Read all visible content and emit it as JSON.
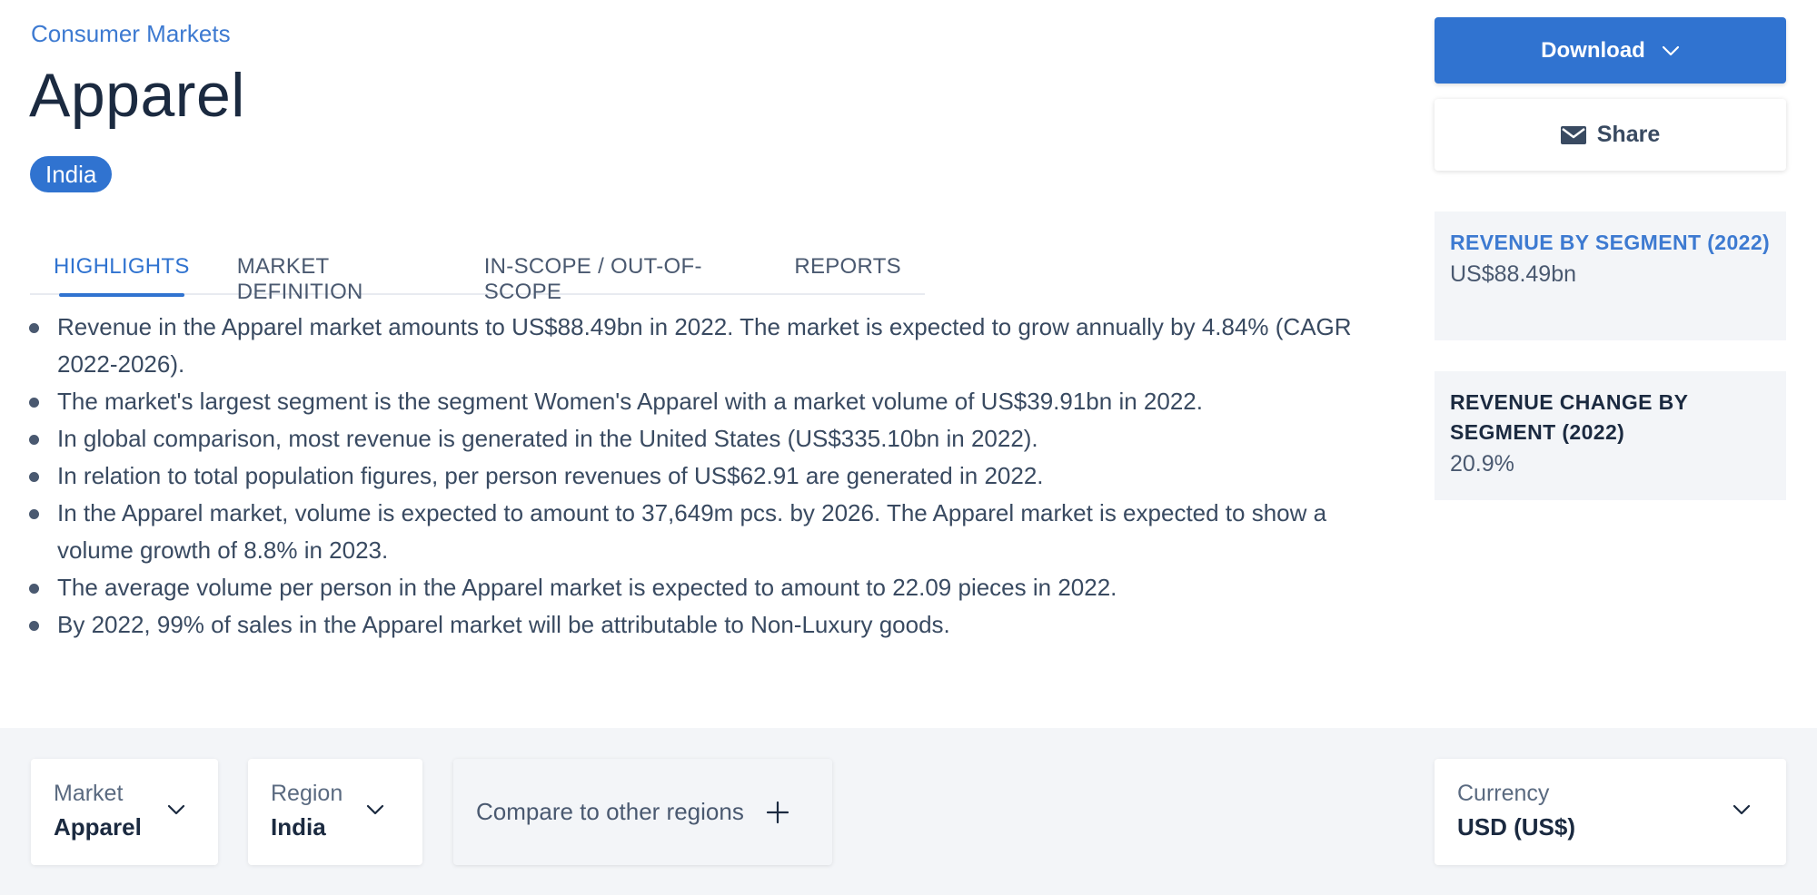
{
  "header": {
    "breadcrumb": "Consumer Markets",
    "title": "Apparel",
    "region_badge": "India"
  },
  "tabs": [
    {
      "label": "HIGHLIGHTS",
      "active": true
    },
    {
      "label": "MARKET DEFINITION",
      "active": false
    },
    {
      "label": "IN-SCOPE / OUT-OF-SCOPE",
      "active": false
    },
    {
      "label": "REPORTS",
      "active": false
    }
  ],
  "highlights": [
    "Revenue in the Apparel market amounts to US$88.49bn in 2022. The market is expected to grow annually by 4.84% (CAGR 2022-2026).",
    "The market's largest segment is the segment Women's Apparel with a market volume of US$39.91bn in 2022.",
    "In global comparison, most revenue is generated in the United States (US$335.10bn in 2022).",
    "In relation to total population figures, per person revenues of US$62.91 are generated in 2022.",
    "In the Apparel market, volume is expected to amount to 37,649m pcs. by 2026. The Apparel market is expected to show a volume growth of 8.8% in 2023.",
    "The average volume per person in the Apparel market is expected to amount to 22.09 pieces in 2022.",
    "By 2022, 99% of sales in the Apparel market will be attributable to Non-Luxury goods."
  ],
  "actions": {
    "download_label": "Download",
    "share_label": "Share"
  },
  "kpis": [
    {
      "label": "REVENUE BY SEGMENT (2022)",
      "value": "US$88.49bn"
    },
    {
      "label": "REVENUE CHANGE BY SEGMENT (2022)",
      "value": "20.9%"
    }
  ],
  "filters": {
    "market": {
      "label": "Market",
      "value": "Apparel"
    },
    "region": {
      "label": "Region",
      "value": "India"
    },
    "compare_label": "Compare to other regions",
    "currency": {
      "label": "Currency",
      "value": "USD (US$)"
    }
  },
  "colors": {
    "accent": "#3073d0",
    "text_dark": "#1b2a40",
    "panel_bg": "#f3f5f8"
  }
}
